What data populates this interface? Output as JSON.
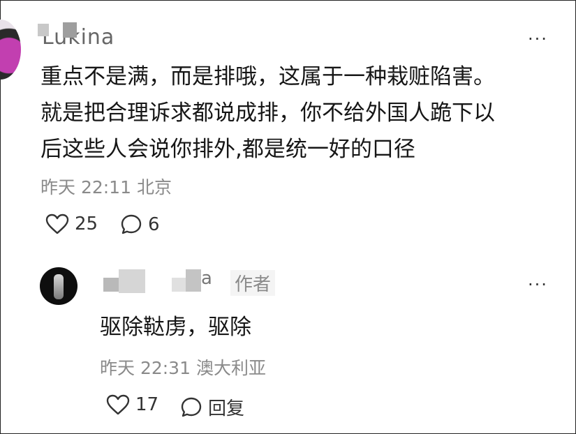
{
  "comment": {
    "username": "Lukina",
    "lines": [
      "重点不是满，而是排哦，这属于一种栽赃陷害。",
      "就是把合理诉求都说成排，你不给外国人跪下以",
      "后这些人会说你排外,都是统一好的口径"
    ],
    "time": "昨天 22:11",
    "location": "北京",
    "likes": "25",
    "replies": "6",
    "more": "···"
  },
  "reply": {
    "username": "a",
    "author_badge": "作者",
    "text": "驱除鞑虏，驱除",
    "time": "昨天 22:31",
    "location": "澳大利亚",
    "likes": "17",
    "reply_label": "回复",
    "more": "···"
  },
  "icons": {
    "like": "heart-outline-icon",
    "reply": "speech-bubble-icon",
    "more": "more-dots-icon"
  }
}
